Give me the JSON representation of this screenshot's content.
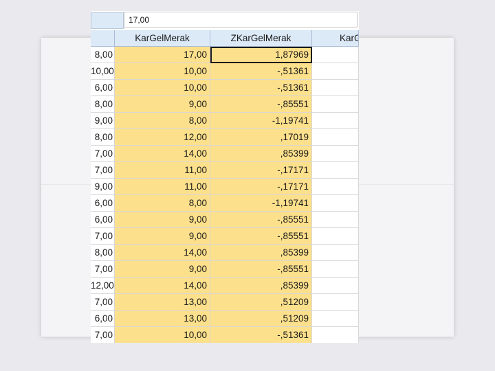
{
  "edit_bar": {
    "cell_value": "17,00"
  },
  "columns": [
    "",
    "KarGelMerak",
    "ZKarGelMerak",
    "KarG"
  ],
  "rows": [
    [
      "8,00",
      "17,00",
      "1,87969"
    ],
    [
      "10,00",
      "10,00",
      "-,51361"
    ],
    [
      "6,00",
      "10,00",
      "-,51361"
    ],
    [
      "8,00",
      "9,00",
      "-,85551"
    ],
    [
      "9,00",
      "8,00",
      "-1,19741"
    ],
    [
      "8,00",
      "12,00",
      ",17019"
    ],
    [
      "7,00",
      "14,00",
      ",85399"
    ],
    [
      "7,00",
      "11,00",
      "-,17171"
    ],
    [
      "9,00",
      "11,00",
      "-,17171"
    ],
    [
      "6,00",
      "8,00",
      "-1,19741"
    ],
    [
      "6,00",
      "9,00",
      "-,85551"
    ],
    [
      "7,00",
      "9,00",
      "-,85551"
    ],
    [
      "8,00",
      "14,00",
      ",85399"
    ],
    [
      "7,00",
      "9,00",
      "-,85551"
    ],
    [
      "12,00",
      "14,00",
      ",85399"
    ],
    [
      "7,00",
      "13,00",
      ",51209"
    ],
    [
      "6,00",
      "13,00",
      ",51209"
    ],
    [
      "7,00",
      "10,00",
      "-,51361"
    ]
  ],
  "colors": {
    "header_bg": "#dce9f7",
    "highlight_bg": "#fde08c",
    "background": "#e9e9ee"
  }
}
